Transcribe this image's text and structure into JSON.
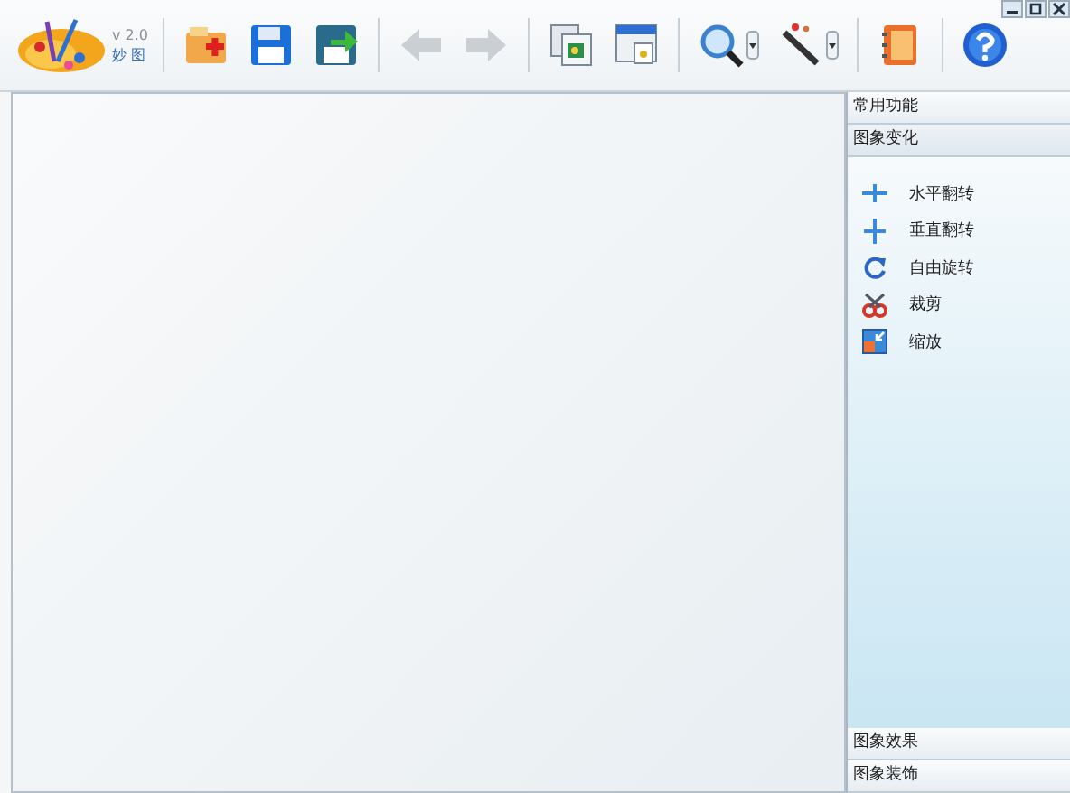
{
  "window": {
    "controls": [
      {
        "kind": "minimize"
      },
      {
        "kind": "restore"
      },
      {
        "kind": "close"
      }
    ]
  },
  "app": {
    "version": "v 2.0",
    "name": "妙 图"
  },
  "toolbar": [
    {
      "kind": "open",
      "disabled": false
    },
    {
      "kind": "save",
      "disabled": false
    },
    {
      "kind": "save-as",
      "disabled": false
    },
    {
      "kind": "sep"
    },
    {
      "kind": "undo",
      "disabled": true
    },
    {
      "kind": "redo",
      "disabled": true
    },
    {
      "kind": "sep"
    },
    {
      "kind": "copy",
      "disabled": false
    },
    {
      "kind": "window",
      "disabled": false
    },
    {
      "kind": "sep"
    },
    {
      "kind": "zoom",
      "disabled": false,
      "dropdown": true
    },
    {
      "kind": "wand",
      "disabled": false,
      "dropdown": true
    },
    {
      "kind": "sep"
    },
    {
      "kind": "book",
      "disabled": false
    },
    {
      "kind": "sep"
    },
    {
      "kind": "help",
      "disabled": false
    }
  ],
  "sidebar": {
    "sections": [
      {
        "title": "常用功能",
        "expanded": false
      },
      {
        "title": "图象变化",
        "expanded": true,
        "items": [
          {
            "kind": "hflip",
            "label": "水平翻转"
          },
          {
            "kind": "vflip",
            "label": "垂直翻转"
          },
          {
            "kind": "rotate",
            "label": "自由旋转"
          },
          {
            "kind": "crop",
            "label": "裁剪"
          },
          {
            "kind": "scale",
            "label": "缩放"
          }
        ]
      },
      {
        "title": "图象效果",
        "expanded": false
      },
      {
        "title": "图象装饰",
        "expanded": false
      }
    ]
  }
}
